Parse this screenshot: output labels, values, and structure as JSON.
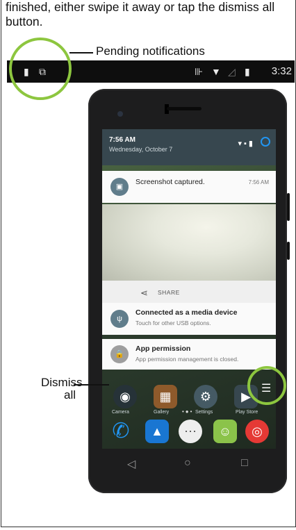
{
  "intro_text": "finished, either swipe it away or tap the dismiss all button.",
  "callouts": {
    "pending": "Pending notifications",
    "dismiss": "Dismiss all"
  },
  "statusbar": {
    "time": "3:32",
    "left_icons": [
      "sd-card-icon",
      "screenshot-icon"
    ],
    "right_icons": [
      "vibrate-icon",
      "wifi-icon",
      "signal-icon",
      "battery-icon"
    ]
  },
  "shade": {
    "time": "7:56 AM",
    "date": "Wednesday, October 7"
  },
  "notifications": [
    {
      "title": "Screenshot captured.",
      "time": "7:56 AM",
      "icon": "image-icon"
    },
    {
      "title": "Connected as a media device",
      "subtitle": "Touch for other USB options.",
      "icon": "usb-icon"
    },
    {
      "title": "App permission",
      "subtitle": "App permission management is closed.",
      "icon": "lock-icon"
    }
  ],
  "share_label": "SHARE",
  "home_apps": [
    "Camera",
    "Gallery",
    "Settings",
    "Play Store"
  ],
  "colors": {
    "accent_ring": "#8dc63f",
    "shade_header": "#37474f",
    "notif_icon": "#607d8b"
  }
}
